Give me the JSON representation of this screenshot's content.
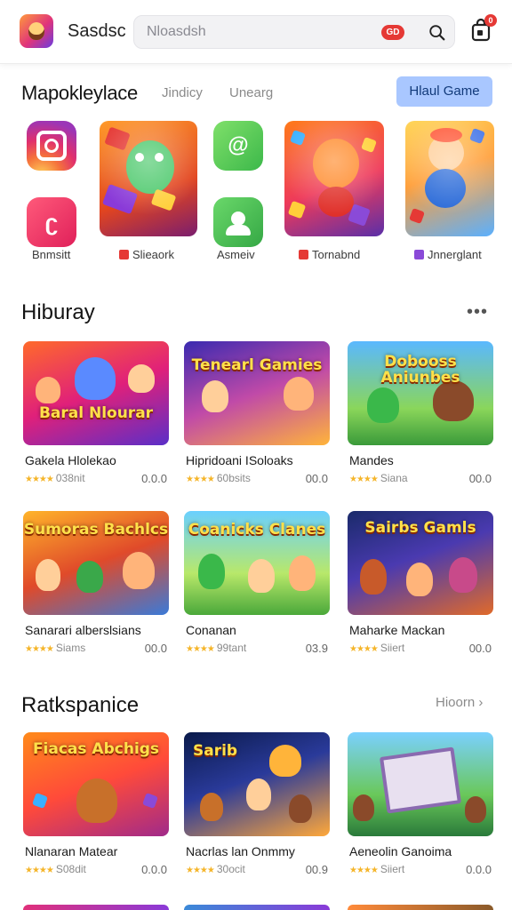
{
  "header": {
    "app_name": "Sasdsc",
    "search_placeholder": "Nloasdsh",
    "search_pill": "GD",
    "bag_badge": "0",
    "icons": [
      "app-logo",
      "search-icon",
      "shopping-bag-icon"
    ]
  },
  "marketplace": {
    "title": "Mapokleylace",
    "tabs": [
      "Jindicy",
      "Unearg"
    ],
    "cta_label": "Hlaul Game",
    "featured_labels": [
      {
        "text": "Bnmsitt",
        "marker_color": ""
      },
      {
        "text": "Slieaork",
        "marker_color": "#e53935"
      },
      {
        "text": "Asmeiv",
        "marker_color": ""
      },
      {
        "text": "Tornabnd",
        "marker_color": "#e53935"
      },
      {
        "text": "Jnnerglant",
        "marker_color": "#8a4ad8"
      }
    ]
  },
  "library": {
    "title": "Hiburay",
    "more_label": "•••",
    "cards": [
      {
        "thumb_text": "Baral Nlourar",
        "name": "Gakela Hlolekao",
        "sub": "038nit",
        "score": "0.0.0"
      },
      {
        "thumb_text": "Tenearl Gamies",
        "name": "Hipridoani ISoloaks",
        "sub": "60bsits",
        "score": "00.0"
      },
      {
        "thumb_text": "Dobooss Aniunbes",
        "name": "Mandes",
        "sub": "Siana",
        "score": "00.0"
      },
      {
        "thumb_text": "Sumoras Bachlcs",
        "name": "Sanarari alberslsians",
        "sub": "Siams",
        "score": "00.0"
      },
      {
        "thumb_text": "Coanicks Clanes",
        "name": "Conanan",
        "sub": "99tant",
        "score": "03.9"
      },
      {
        "thumb_text": "Sairbs Gamls",
        "name": "Maharke Mackan",
        "sub": "Siiert",
        "score": "00.0"
      }
    ]
  },
  "marketplace2": {
    "title": "Ratkspanice",
    "more_label": "Hioorn",
    "cards": [
      {
        "thumb_text": "Fiacas Abchigs",
        "name": "Nlanaran Matear",
        "sub": "S08dit",
        "score": "0.0.0"
      },
      {
        "thumb_text": "Sarib",
        "name": "Nacrlas lan Onmmy",
        "sub": "30ocit",
        "score": "00.9"
      },
      {
        "thumb_text": "",
        "name": "Aeneolin Ganoima",
        "sub": "Siiert",
        "score": "0.0.0"
      }
    ]
  },
  "rating_stars": "★★★★",
  "feat_glyphs": {
    "red_icon": "ʗ",
    "green_icon": "@"
  }
}
